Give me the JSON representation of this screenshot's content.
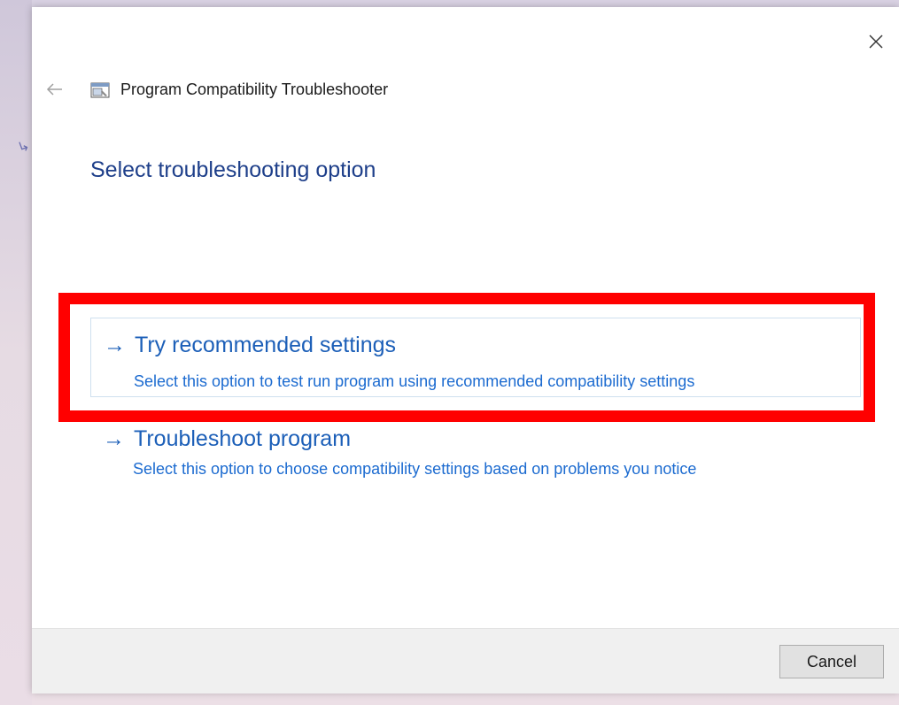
{
  "window": {
    "title": "Program Compatibility Troubleshooter"
  },
  "page": {
    "heading": "Select troubleshooting option"
  },
  "options": [
    {
      "label": "Try recommended settings",
      "description": "Select this option to test run program using recommended compatibility settings",
      "highlighted": true
    },
    {
      "label": "Troubleshoot program",
      "description": "Select this option to choose compatibility settings based on problems you notice",
      "highlighted": false
    }
  ],
  "footer": {
    "cancel_label": "Cancel"
  },
  "icons": {
    "close": "close-icon",
    "back": "back-arrow-icon",
    "app": "troubleshooter-app-icon",
    "option_arrow": "arrow-right-icon"
  },
  "colors": {
    "heading": "#1e3f8a",
    "link": "#1c5fb8",
    "highlight": "#ff0000"
  }
}
